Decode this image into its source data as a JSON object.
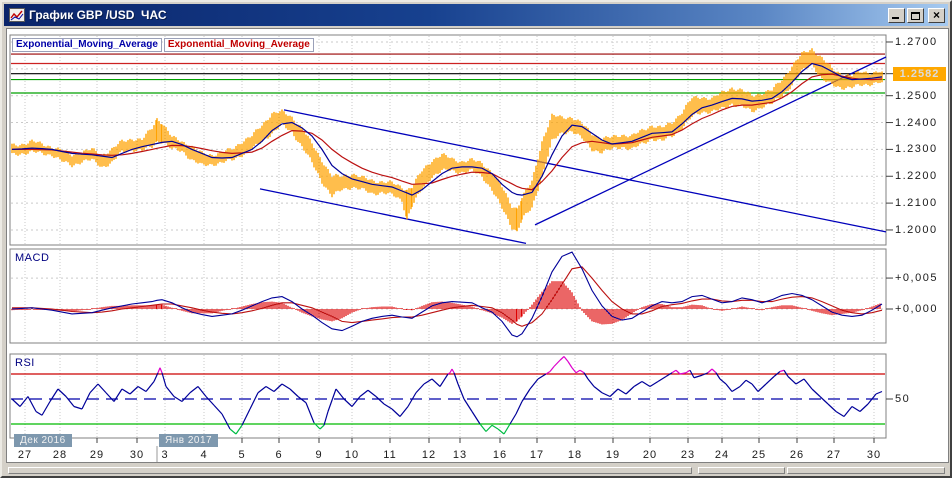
{
  "window": {
    "title": "График GBP /USD  ЧАС",
    "buttons": {
      "minimize": "minimize",
      "maximize": "maximize",
      "close": "×"
    }
  },
  "chart_data": {
    "type": "line",
    "symbol": "GBP/USD",
    "timeframe": "ЧАС",
    "main": {
      "legend": [
        {
          "label": "Exponential_Moving_Average",
          "color": "#0000A8"
        },
        {
          "label": "Exponential_Moving_Average",
          "color": "#C00000"
        }
      ],
      "ylim": [
        1.1944,
        1.2726
      ],
      "grid_prices": [
        1.2,
        1.21,
        1.22,
        1.23,
        1.24,
        1.25,
        1.26,
        1.27
      ],
      "y_labels": [
        {
          "text": "1.2700",
          "price": 1.27
        },
        {
          "text": "1.2500",
          "price": 1.25
        },
        {
          "text": "1.2400",
          "price": 1.24
        },
        {
          "text": "1.2300",
          "price": 1.23
        },
        {
          "text": "1.2200",
          "price": 1.22
        },
        {
          "text": "1.2100",
          "price": 1.21
        },
        {
          "text": "1.2000",
          "price": 1.2
        }
      ],
      "current_price": {
        "text": "1.2582",
        "price": 1.2582,
        "bg": "#FFA800",
        "fg": "#DCDCDC"
      },
      "levels": [
        {
          "price": 1.2655,
          "color": "#990000"
        },
        {
          "price": 1.262,
          "color": "#CC2222"
        },
        {
          "price": 1.2582,
          "color": "#000000"
        },
        {
          "price": 1.256,
          "color": "#00A000"
        },
        {
          "price": 1.251,
          "color": "#00A000"
        }
      ],
      "trend_lines": [
        {
          "x1": 282,
          "p1": 1.2447,
          "x2": 884,
          "p2": 1.1993
        },
        {
          "x1": 258,
          "p1": 1.2153,
          "x2": 524,
          "p2": 1.195
        },
        {
          "x1": 533,
          "p1": 1.2019,
          "x2": 884,
          "p2": 1.2644
        }
      ],
      "bar_color": "#FFA200",
      "ema_fast_color": "#000099",
      "ema_slow_color": "#BB1111",
      "trend_color": "#0000BB",
      "price_x": [
        10,
        20,
        30,
        40,
        50,
        60,
        70,
        80,
        90,
        100,
        110,
        120,
        130,
        140,
        150,
        155,
        160,
        170,
        180,
        190,
        200,
        210,
        220,
        230,
        240,
        250,
        260,
        270,
        280,
        290,
        300,
        310,
        320,
        330,
        340,
        350,
        360,
        370,
        380,
        390,
        400,
        405,
        410,
        420,
        430,
        440,
        450,
        460,
        470,
        480,
        490,
        500,
        510,
        515,
        520,
        530,
        540,
        550,
        560,
        570,
        580,
        590,
        600,
        610,
        620,
        630,
        640,
        650,
        660,
        670,
        680,
        690,
        700,
        710,
        720,
        730,
        740,
        750,
        760,
        770,
        780,
        790,
        800,
        810,
        820,
        830,
        840,
        850,
        860,
        870,
        880
      ],
      "price_low": [
        1.228,
        1.2285,
        1.229,
        1.2285,
        1.228,
        1.2255,
        1.224,
        1.2255,
        1.226,
        1.2235,
        1.225,
        1.229,
        1.23,
        1.2295,
        1.231,
        1.233,
        1.233,
        1.23,
        1.2295,
        1.226,
        1.224,
        1.2245,
        1.225,
        1.226,
        1.228,
        1.23,
        1.233,
        1.236,
        1.239,
        1.2365,
        1.231,
        1.225,
        1.218,
        1.2125,
        1.215,
        1.216,
        1.215,
        1.2135,
        1.214,
        1.213,
        1.211,
        1.204,
        1.209,
        1.215,
        1.22,
        1.222,
        1.222,
        1.2215,
        1.222,
        1.22,
        1.215,
        1.208,
        1.201,
        1.1995,
        1.204,
        1.208,
        1.22,
        1.233,
        1.236,
        1.237,
        1.234,
        1.23,
        1.229,
        1.23,
        1.231,
        1.23,
        1.232,
        1.234,
        1.233,
        1.235,
        1.238,
        1.242,
        1.244,
        1.244,
        1.245,
        1.247,
        1.246,
        1.244,
        1.246,
        1.247,
        1.25,
        1.254,
        1.259,
        1.262,
        1.256,
        1.254,
        1.253,
        1.253,
        1.254,
        1.2545,
        1.255
      ],
      "price_high": [
        1.2315,
        1.232,
        1.233,
        1.232,
        1.231,
        1.2295,
        1.228,
        1.229,
        1.23,
        1.228,
        1.23,
        1.233,
        1.234,
        1.2335,
        1.238,
        1.2415,
        1.24,
        1.2345,
        1.233,
        1.231,
        1.2285,
        1.228,
        1.229,
        1.23,
        1.233,
        1.235,
        1.239,
        1.2435,
        1.244,
        1.242,
        1.238,
        1.232,
        1.226,
        1.22,
        1.22,
        1.221,
        1.2195,
        1.2185,
        1.218,
        1.2175,
        1.216,
        1.215,
        1.216,
        1.222,
        1.226,
        1.228,
        1.2265,
        1.2255,
        1.226,
        1.225,
        1.2215,
        1.216,
        1.209,
        1.208,
        1.212,
        1.218,
        1.233,
        1.2425,
        1.242,
        1.242,
        1.2395,
        1.236,
        1.234,
        1.2345,
        1.2355,
        1.235,
        1.237,
        1.239,
        1.238,
        1.24,
        1.244,
        1.249,
        1.2495,
        1.249,
        1.251,
        1.253,
        1.252,
        1.25,
        1.251,
        1.252,
        1.256,
        1.261,
        1.2655,
        1.2675,
        1.264,
        1.26,
        1.258,
        1.2575,
        1.259,
        1.2585,
        1.259
      ],
      "ema_fast": [
        1.23,
        1.2302,
        1.2305,
        1.2303,
        1.23,
        1.2292,
        1.2285,
        1.2282,
        1.228,
        1.2275,
        1.227,
        1.2285,
        1.23,
        1.231,
        1.2318,
        1.2322,
        1.2326,
        1.233,
        1.2318,
        1.23,
        1.2285,
        1.227,
        1.2268,
        1.227,
        1.2285,
        1.23,
        1.233,
        1.237,
        1.2395,
        1.24,
        1.238,
        1.235,
        1.23,
        1.224,
        1.221,
        1.219,
        1.218,
        1.217,
        1.2165,
        1.216,
        1.2145,
        1.2138,
        1.213,
        1.215,
        1.218,
        1.221,
        1.223,
        1.2235,
        1.2235,
        1.223,
        1.221,
        1.217,
        1.214,
        1.2132,
        1.213,
        1.214,
        1.22,
        1.228,
        1.235,
        1.239,
        1.2385,
        1.236,
        1.2335,
        1.232,
        1.2325,
        1.233,
        1.2345,
        1.236,
        1.2362,
        1.2365,
        1.2395,
        1.243,
        1.2455,
        1.2465,
        1.2478,
        1.249,
        1.2488,
        1.248,
        1.2483,
        1.249,
        1.2515,
        1.255,
        1.259,
        1.262,
        1.261,
        1.259,
        1.257,
        1.256,
        1.2562,
        1.2565,
        1.257
      ],
      "ema_slow": [
        1.23,
        1.23,
        1.23,
        1.2299,
        1.2298,
        1.2294,
        1.229,
        1.2286,
        1.2283,
        1.228,
        1.2278,
        1.228,
        1.2285,
        1.2292,
        1.23,
        1.2304,
        1.2308,
        1.2315,
        1.2314,
        1.231,
        1.2303,
        1.2295,
        1.2289,
        1.2285,
        1.2287,
        1.229,
        1.2305,
        1.233,
        1.2352,
        1.237,
        1.2368,
        1.236,
        1.2335,
        1.23,
        1.2272,
        1.225,
        1.223,
        1.2215,
        1.2204,
        1.2195,
        1.2182,
        1.2176,
        1.217,
        1.2172,
        1.2175,
        1.2188,
        1.22,
        1.2208,
        1.2215,
        1.2214,
        1.221,
        1.219,
        1.2172,
        1.2162,
        1.2155,
        1.215,
        1.218,
        1.222,
        1.227,
        1.231,
        1.2325,
        1.233,
        1.2325,
        1.232,
        1.2322,
        1.2325,
        1.2335,
        1.2345,
        1.235,
        1.2355,
        1.2372,
        1.2395,
        1.2415,
        1.243,
        1.2447,
        1.246,
        1.2465,
        1.2465,
        1.247,
        1.2475,
        1.2492,
        1.2515,
        1.2545,
        1.257,
        1.2578,
        1.258,
        1.2573,
        1.2565,
        1.2561,
        1.256,
        1.2562
      ]
    },
    "macd": {
      "label": "MACD",
      "ylim": [
        -0.0055,
        0.0097
      ],
      "grid_values": [
        0.0,
        0.005
      ],
      "y_labels": [
        {
          "text": "+0,005",
          "value": 0.005
        },
        {
          "text": "+0,000",
          "value": 0.0
        }
      ],
      "macd_color": "#000099",
      "signal_color": "#BB1111",
      "hist_color": "#DD0000",
      "macd": [
        0.0,
        0.0001,
        0.0002,
        0.0,
        -0.0002,
        -0.0005,
        -0.0008,
        -0.0007,
        -0.0006,
        -0.0002,
        0.0002,
        0.0005,
        0.0008,
        0.001,
        0.0012,
        0.0014,
        0.0015,
        0.001,
        0.0002,
        -0.0005,
        -0.0009,
        -0.0012,
        -0.001,
        -0.0008,
        -0.0002,
        0.0005,
        0.0012,
        0.0018,
        0.002,
        0.0012,
        0.0,
        -0.001,
        -0.0022,
        -0.0032,
        -0.0035,
        -0.0028,
        -0.002,
        -0.0015,
        -0.0012,
        -0.001,
        -0.0013,
        -0.0014,
        -0.0015,
        -0.0005,
        0.0005,
        0.001,
        0.0012,
        0.0011,
        0.001,
        0.0002,
        -0.0005,
        -0.002,
        -0.0042,
        -0.0045,
        -0.004,
        -0.0015,
        0.002,
        0.006,
        0.0085,
        0.0092,
        0.0065,
        0.003,
        0.0005,
        -0.0012,
        -0.0018,
        -0.0015,
        -0.0005,
        0.0005,
        0.0012,
        0.001,
        0.0012,
        0.002,
        0.0022,
        0.0016,
        0.001,
        0.0012,
        0.0018,
        0.0015,
        0.001,
        0.0015,
        0.0022,
        0.0025,
        0.0022,
        0.0015,
        0.0005,
        -0.0005,
        -0.001,
        -0.0012,
        -0.001,
        -0.0002,
        0.0008
      ],
      "signal": [
        0.0002,
        0.0002,
        0.0002,
        0.0001,
        0.0,
        -0.0002,
        -0.0004,
        -0.0005,
        -0.0006,
        -0.0005,
        -0.0003,
        0.0,
        0.0002,
        0.0004,
        0.0006,
        0.0007,
        0.0008,
        0.0008,
        0.0005,
        0.0002,
        -0.0002,
        -0.0005,
        -0.0007,
        -0.0008,
        -0.0006,
        -0.0003,
        0.0001,
        0.0006,
        0.001,
        0.001,
        0.0006,
        0.0002,
        -0.0005,
        -0.0012,
        -0.002,
        -0.0022,
        -0.002,
        -0.0018,
        -0.0016,
        -0.0014,
        -0.0013,
        -0.0013,
        -0.0013,
        -0.001,
        -0.0006,
        -0.0002,
        0.0002,
        0.0004,
        0.0006,
        0.0004,
        0.0002,
        -0.0006,
        -0.0018,
        -0.0025,
        -0.0028,
        -0.0022,
        -0.0008,
        0.0015,
        0.004,
        0.0065,
        0.0068,
        0.005,
        0.003,
        0.0012,
        0.0,
        -0.0008,
        -0.0008,
        -0.0003,
        0.0004,
        0.0007,
        0.0009,
        0.0013,
        0.0016,
        0.0016,
        0.0013,
        0.0012,
        0.0014,
        0.0014,
        0.0012,
        0.0012,
        0.0016,
        0.0019,
        0.002,
        0.0018,
        0.0012,
        0.0005,
        -0.0002,
        -0.0006,
        -0.0008,
        -0.0006,
        -0.0002
      ]
    },
    "rsi": {
      "label": "RSI",
      "ylim": [
        18.8,
        86
      ],
      "levels": [
        {
          "value": 70,
          "color": "#CC0000",
          "dash": ""
        },
        {
          "value": 50,
          "color": "#0000AA",
          "dash": "12,7"
        },
        {
          "value": 30,
          "color": "#00BB00",
          "dash": ""
        }
      ],
      "y_labels": [
        {
          "text": "50",
          "value": 50
        }
      ],
      "line_color": "#000099",
      "overbought_color": "#DD00CC",
      "oversold_color": "#00BB44",
      "ob_threshold": 70,
      "os_threshold": 32,
      "x": [
        10,
        18,
        26,
        34,
        40,
        48,
        56,
        64,
        72,
        80,
        88,
        96,
        104,
        112,
        120,
        128,
        136,
        144,
        152,
        156,
        158,
        160,
        164,
        172,
        180,
        188,
        196,
        204,
        212,
        220,
        228,
        234,
        240,
        248,
        256,
        264,
        272,
        280,
        288,
        296,
        304,
        312,
        318,
        322,
        326,
        334,
        342,
        350,
        358,
        366,
        374,
        382,
        390,
        398,
        406,
        414,
        422,
        430,
        438,
        446,
        448,
        450,
        452,
        456,
        462,
        470,
        478,
        484,
        490,
        496,
        502,
        508,
        514,
        520,
        528,
        536,
        544,
        548,
        552,
        558,
        562,
        566,
        570,
        574,
        578,
        582,
        586,
        592,
        600,
        608,
        616,
        624,
        632,
        640,
        648,
        656,
        664,
        670,
        674,
        678,
        684,
        688,
        692,
        700,
        706,
        710,
        714,
        718,
        724,
        730,
        738,
        744,
        750,
        756,
        764,
        772,
        778,
        782,
        786,
        794,
        802,
        810,
        818,
        826,
        834,
        842,
        850,
        858,
        866,
        874,
        880
      ],
      "values": [
        50,
        44,
        52,
        40,
        37,
        48,
        58,
        52,
        44,
        42,
        55,
        62,
        55,
        48,
        58,
        54,
        60,
        56,
        64,
        71,
        75,
        71,
        60,
        52,
        48,
        55,
        60,
        52,
        45,
        38,
        26,
        22,
        29,
        42,
        55,
        60,
        56,
        62,
        58,
        52,
        47,
        31,
        26,
        29,
        40,
        58,
        50,
        44,
        52,
        57,
        52,
        46,
        42,
        36,
        44,
        55,
        62,
        66,
        60,
        70,
        71,
        74,
        71,
        62,
        50,
        40,
        30,
        24,
        29,
        26,
        22,
        30,
        38,
        48,
        58,
        66,
        70,
        72,
        76,
        81,
        84,
        80,
        75,
        71,
        73,
        71,
        66,
        60,
        55,
        52,
        58,
        54,
        60,
        64,
        60,
        64,
        68,
        71,
        73,
        70,
        71,
        73,
        67,
        69,
        71,
        74,
        71,
        66,
        62,
        56,
        60,
        65,
        62,
        56,
        62,
        68,
        72,
        73,
        68,
        62,
        66,
        58,
        52,
        46,
        40,
        36,
        44,
        40,
        46,
        54,
        56
      ]
    },
    "x_axis": {
      "day_labels": [
        {
          "text": "27",
          "x": 23
        },
        {
          "text": "28",
          "x": 58
        },
        {
          "text": "29",
          "x": 95
        },
        {
          "text": "30",
          "x": 135
        },
        {
          "text": "3",
          "x": 163
        },
        {
          "text": "4",
          "x": 202
        },
        {
          "text": "5",
          "x": 240
        },
        {
          "text": "6",
          "x": 277
        },
        {
          "text": "9",
          "x": 317
        },
        {
          "text": "10",
          "x": 350
        },
        {
          "text": "11",
          "x": 388
        },
        {
          "text": "12",
          "x": 427
        },
        {
          "text": "13",
          "x": 458
        },
        {
          "text": "16",
          "x": 498
        },
        {
          "text": "17",
          "x": 535
        },
        {
          "text": "18",
          "x": 573
        },
        {
          "text": "19",
          "x": 611
        },
        {
          "text": "20",
          "x": 648
        },
        {
          "text": "23",
          "x": 686
        },
        {
          "text": "24",
          "x": 720
        },
        {
          "text": "25",
          "x": 757
        },
        {
          "text": "26",
          "x": 795
        },
        {
          "text": "27",
          "x": 832
        },
        {
          "text": "30",
          "x": 872
        }
      ],
      "month_labels": [
        {
          "text": "Дек 2016",
          "x": 12
        },
        {
          "text": "Янв 2017",
          "x": 157
        }
      ]
    }
  }
}
